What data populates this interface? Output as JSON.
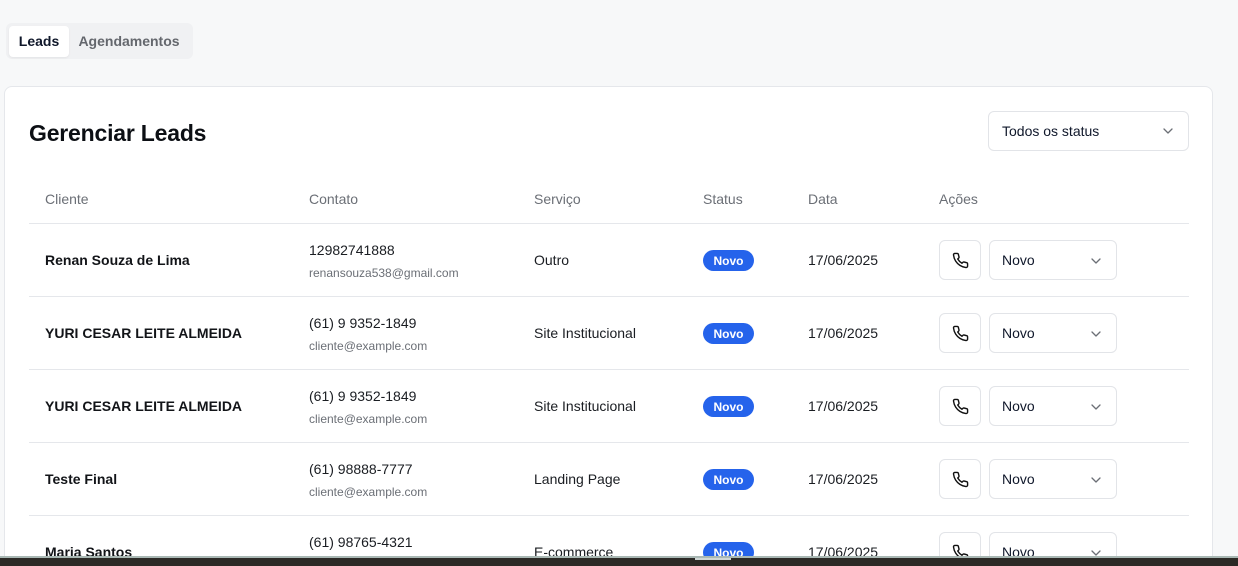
{
  "tabs": [
    {
      "label": "Leads",
      "active": true
    },
    {
      "label": "Agendamentos",
      "active": false
    }
  ],
  "card": {
    "title": "Gerenciar Leads",
    "status_filter": "Todos os status"
  },
  "table": {
    "headers": [
      "Cliente",
      "Contato",
      "Serviço",
      "Status",
      "Data",
      "Ações"
    ],
    "rows": [
      {
        "name": "Renan Souza de Lima",
        "phone": "12982741888",
        "email": "renansouza538@gmail.com",
        "service": "Outro",
        "status": "Novo",
        "date": "17/06/2025",
        "action_status": "Novo"
      },
      {
        "name": "YURI CESAR LEITE ALMEIDA",
        "phone": "(61) 9 9352-1849",
        "email": "cliente@example.com",
        "service": "Site Institucional",
        "status": "Novo",
        "date": "17/06/2025",
        "action_status": "Novo"
      },
      {
        "name": "YURI CESAR LEITE ALMEIDA",
        "phone": "(61) 9 9352-1849",
        "email": "cliente@example.com",
        "service": "Site Institucional",
        "status": "Novo",
        "date": "17/06/2025",
        "action_status": "Novo"
      },
      {
        "name": "Teste Final",
        "phone": "(61) 98888-7777",
        "email": "cliente@example.com",
        "service": "Landing Page",
        "status": "Novo",
        "date": "17/06/2025",
        "action_status": "Novo"
      },
      {
        "name": "Maria Santos",
        "phone": "(61) 98765-4321",
        "email": "",
        "service": "E-commerce",
        "status": "Novo",
        "date": "17/06/2025",
        "action_status": "Novo"
      }
    ]
  },
  "icons": {
    "call": "phone-icon",
    "dropdown": "chevron-down-icon"
  },
  "colors": {
    "badge": "#2563eb",
    "background": "#f7f8f9",
    "card": "#ffffff"
  }
}
